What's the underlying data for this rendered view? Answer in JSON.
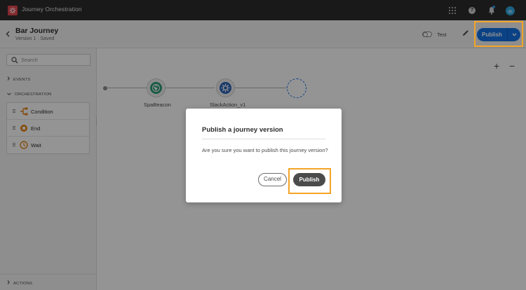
{
  "app": {
    "title": "Journey Orchestration"
  },
  "header": {
    "journey_name": "Bar Journey",
    "journey_meta": "Version 1 · Saved",
    "test_label": "Test",
    "publish_label": "Publish"
  },
  "sidebar": {
    "search_placeholder": "Search",
    "sections": {
      "events": "EVENTS",
      "orchestration": "ORCHESTRATION",
      "actions": "ACTIONS"
    },
    "orchestration_items": [
      {
        "label": "Condition",
        "icon": "condition-icon"
      },
      {
        "label": "End",
        "icon": "end-icon"
      },
      {
        "label": "Wait",
        "icon": "wait-icon"
      }
    ]
  },
  "canvas": {
    "nodes": [
      {
        "label": "SpaBeacon",
        "icon": "globe-icon"
      },
      {
        "label": "SlackAction_v1",
        "icon": "action-gear-icon"
      }
    ],
    "zoom_in": "+",
    "zoom_out": "−"
  },
  "dialog": {
    "title": "Publish a journey version",
    "message": "Are you sure you want to publish this journey version?",
    "cancel_label": "Cancel",
    "confirm_label": "Publish"
  },
  "colors": {
    "accent": "#1473e6",
    "highlight": "#f3a428",
    "topbar": "#2c2c2c",
    "brand": "#e34850"
  }
}
